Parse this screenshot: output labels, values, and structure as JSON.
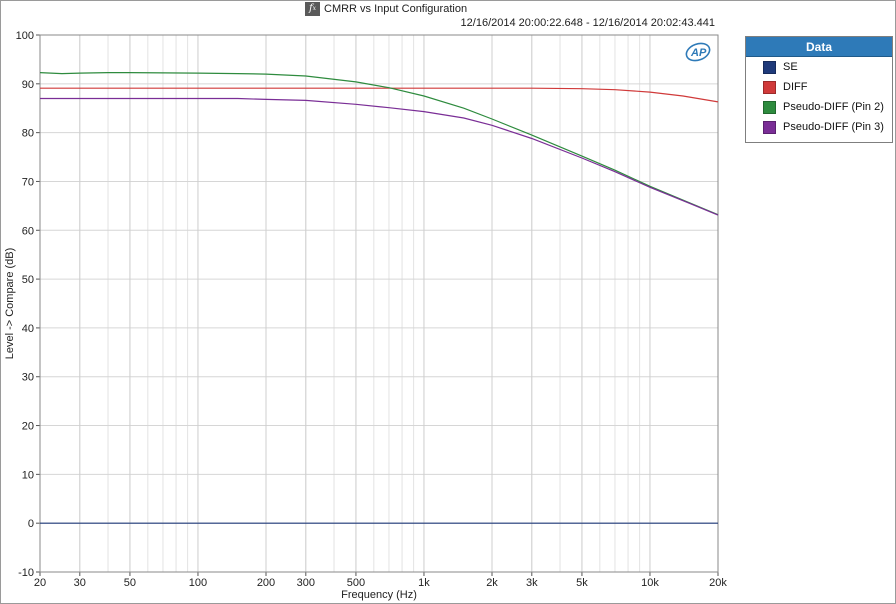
{
  "header": {
    "title": "CMRR vs Input Configuration",
    "daterange": "12/16/2014 20:00:22.648 - 12/16/2014 20:02:43.441",
    "icon": "fx-icon"
  },
  "legend": {
    "title": "Data",
    "items": [
      {
        "label": "SE",
        "color": "#1f3a7a"
      },
      {
        "label": "DIFF",
        "color": "#d03a3a"
      },
      {
        "label": "Pseudo-DIFF (Pin 2)",
        "color": "#2e8b3e"
      },
      {
        "label": "Pseudo-DIFF (Pin 3)",
        "color": "#7a2e96"
      }
    ]
  },
  "chart_data": {
    "type": "line",
    "xlabel": "Frequency (Hz)",
    "ylabel": "Level -> Compare (dB)",
    "xscale": "log",
    "xlim": [
      20,
      20000
    ],
    "ylim": [
      -10,
      100
    ],
    "grid": true,
    "legend_position": "right",
    "x_ticks": [
      {
        "v": 20,
        "label": "20"
      },
      {
        "v": 30,
        "label": "30"
      },
      {
        "v": 50,
        "label": "50"
      },
      {
        "v": 100,
        "label": "100"
      },
      {
        "v": 200,
        "label": "200"
      },
      {
        "v": 300,
        "label": "300"
      },
      {
        "v": 500,
        "label": "500"
      },
      {
        "v": 1000,
        "label": "1k"
      },
      {
        "v": 2000,
        "label": "2k"
      },
      {
        "v": 3000,
        "label": "3k"
      },
      {
        "v": 5000,
        "label": "5k"
      },
      {
        "v": 10000,
        "label": "10k"
      },
      {
        "v": 20000,
        "label": "20k"
      }
    ],
    "y_ticks": [
      -10,
      0,
      10,
      20,
      30,
      40,
      50,
      60,
      70,
      80,
      90,
      100
    ],
    "series": [
      {
        "name": "SE",
        "color": "#1f3a7a",
        "x": [
          20,
          20000
        ],
        "y": [
          0,
          0
        ]
      },
      {
        "name": "DIFF",
        "color": "#d03a3a",
        "x": [
          20,
          100,
          500,
          1000,
          2000,
          3000,
          5000,
          7000,
          10000,
          14000,
          20000
        ],
        "y": [
          89.1,
          89.1,
          89.1,
          89.1,
          89.1,
          89.1,
          89.0,
          88.8,
          88.3,
          87.5,
          86.3
        ]
      },
      {
        "name": "Pseudo-DIFF (Pin 2)",
        "color": "#2e8b3e",
        "x": [
          20,
          25,
          30,
          40,
          50,
          100,
          150,
          200,
          300,
          500,
          700,
          1000,
          1500,
          2000,
          3000,
          5000,
          7000,
          10000,
          15000,
          20000
        ],
        "y": [
          92.3,
          92.1,
          92.2,
          92.3,
          92.3,
          92.2,
          92.1,
          92.0,
          91.6,
          90.4,
          89.2,
          87.5,
          85.0,
          82.8,
          79.5,
          75.2,
          72.3,
          69.0,
          65.6,
          63.2
        ]
      },
      {
        "name": "Pseudo-DIFF (Pin 3)",
        "color": "#7a2e96",
        "x": [
          20,
          30,
          50,
          100,
          150,
          200,
          300,
          500,
          700,
          1000,
          1500,
          2000,
          3000,
          5000,
          7000,
          10000,
          15000,
          20000
        ],
        "y": [
          87.0,
          87.0,
          87.0,
          87.0,
          87.0,
          86.8,
          86.6,
          85.8,
          85.1,
          84.3,
          83.0,
          81.5,
          78.8,
          74.8,
          72.0,
          68.8,
          65.5,
          63.1
        ]
      }
    ]
  }
}
